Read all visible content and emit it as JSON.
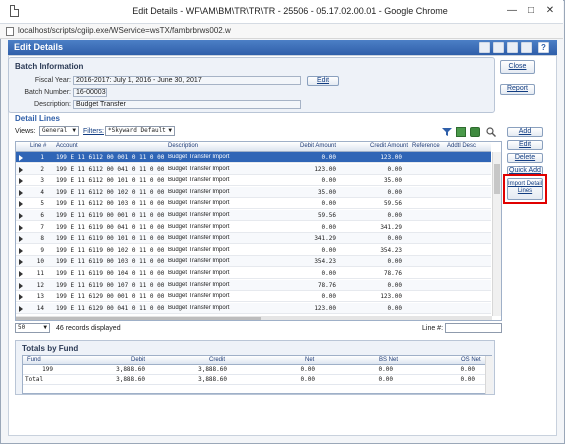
{
  "window": {
    "title": "Edit Details - WF\\AM\\BM\\TR\\TR\\TR - 25506 - 05.17.02.00.01 - Google Chrome",
    "minimize_glyph": "—",
    "maximize_glyph": "□",
    "close_glyph": "✕"
  },
  "address_bar": {
    "url": "localhost/scripts/cgiip.exe/WService=wsTX/fambrbrws002.w"
  },
  "header": {
    "title": "Edit Details",
    "help_label": "?",
    "toolbar_icons": [
      "export-icon",
      "print-preview-icon",
      "attachment-icon",
      "print-icon",
      "help-icon"
    ]
  },
  "batch": {
    "section_title": "Batch Information",
    "fiscal_year_label": "Fiscal Year:",
    "fiscal_year_value": "2016-2017: July 1, 2016 - June 30, 2017",
    "batch_number_label": "Batch Number:",
    "batch_number_value": "16-00003",
    "description_label": "Description:",
    "description_value": "Budget Transfer",
    "edit_button": "Edit"
  },
  "right_buttons": {
    "close": "Close",
    "report": "Report"
  },
  "detail": {
    "section_title": "Detail Lines",
    "views_label": "Views:",
    "views_value": "General",
    "filters_label": "Filters:",
    "filters_value": "*Skyward Default",
    "columns": [
      "Line #",
      "Account",
      "Description",
      "Debit Amount",
      "Credit Amount",
      "Reference",
      "Addtl Desc"
    ],
    "rows": [
      {
        "line": "1",
        "account": "199 E 11 6112 00 001 0 11 0 00",
        "description": "Budget Transfer Import",
        "debit": "0.00",
        "credit": "123.00"
      },
      {
        "line": "2",
        "account": "199 E 11 6112 00 041 0 11 0 00",
        "description": "Budget Transfer Import",
        "debit": "123.00",
        "credit": "0.00"
      },
      {
        "line": "3",
        "account": "199 E 11 6112 00 101 0 11 0 00",
        "description": "Budget Transfer Import",
        "debit": "0.00",
        "credit": "35.00"
      },
      {
        "line": "4",
        "account": "199 E 11 6112 00 102 0 11 0 00",
        "description": "Budget Transfer Import",
        "debit": "35.00",
        "credit": "0.00"
      },
      {
        "line": "5",
        "account": "199 E 11 6112 00 103 0 11 0 00",
        "description": "Budget Transfer Import",
        "debit": "0.00",
        "credit": "59.56"
      },
      {
        "line": "6",
        "account": "199 E 11 6119 00 001 0 11 0 00",
        "description": "Budget Transfer Import",
        "debit": "59.56",
        "credit": "0.00"
      },
      {
        "line": "7",
        "account": "199 E 11 6119 00 041 0 11 0 00",
        "description": "Budget Transfer Import",
        "debit": "0.00",
        "credit": "341.29"
      },
      {
        "line": "8",
        "account": "199 E 11 6119 00 101 0 11 0 00",
        "description": "Budget Transfer Import",
        "debit": "341.29",
        "credit": "0.00"
      },
      {
        "line": "9",
        "account": "199 E 11 6119 00 102 0 11 0 00",
        "description": "Budget Transfer Import",
        "debit": "0.00",
        "credit": "354.23"
      },
      {
        "line": "10",
        "account": "199 E 11 6119 00 103 0 11 0 00",
        "description": "Budget Transfer Import",
        "debit": "354.23",
        "credit": "0.00"
      },
      {
        "line": "11",
        "account": "199 E 11 6119 00 104 0 11 0 00",
        "description": "Budget Transfer Import",
        "debit": "0.00",
        "credit": "78.76"
      },
      {
        "line": "12",
        "account": "199 E 11 6119 00 107 0 11 0 00",
        "description": "Budget Transfer Import",
        "debit": "78.76",
        "credit": "0.00"
      },
      {
        "line": "13",
        "account": "199 E 11 6129 00 001 0 11 0 00",
        "description": "Budget Transfer Import",
        "debit": "0.00",
        "credit": "123.00"
      },
      {
        "line": "14",
        "account": "199 E 11 6129 00 041 0 11 0 00",
        "description": "Budget Transfer Import",
        "debit": "123.00",
        "credit": "0.00"
      }
    ],
    "page_size": "50",
    "records_text": "46 records displayed",
    "line_search_label": "Line #:"
  },
  "side_buttons": {
    "add": "Add",
    "edit": "Edit",
    "delete": "Delete",
    "quick_add": "Quick Add",
    "import_line1": "Import Detail",
    "import_line2": "Lines"
  },
  "totals": {
    "section_title": "Totals by Fund",
    "columns": [
      "Fund",
      "Debit",
      "Credit",
      "Net",
      "BS Net",
      "OS Net"
    ],
    "rows": [
      {
        "fund": "199",
        "debit": "3,888.60",
        "credit": "3,888.60",
        "net": "0.00",
        "bs_net": "0.00",
        "os_net": "0.00"
      },
      {
        "fund": "Total",
        "debit": "3,888.60",
        "credit": "3,888.60",
        "net": "0.00",
        "bs_net": "0.00",
        "os_net": "0.00"
      }
    ]
  },
  "colors": {
    "header_blue": "#2f5fa9",
    "selected_row": "#2f65b6",
    "highlight_red": "#e00000"
  }
}
